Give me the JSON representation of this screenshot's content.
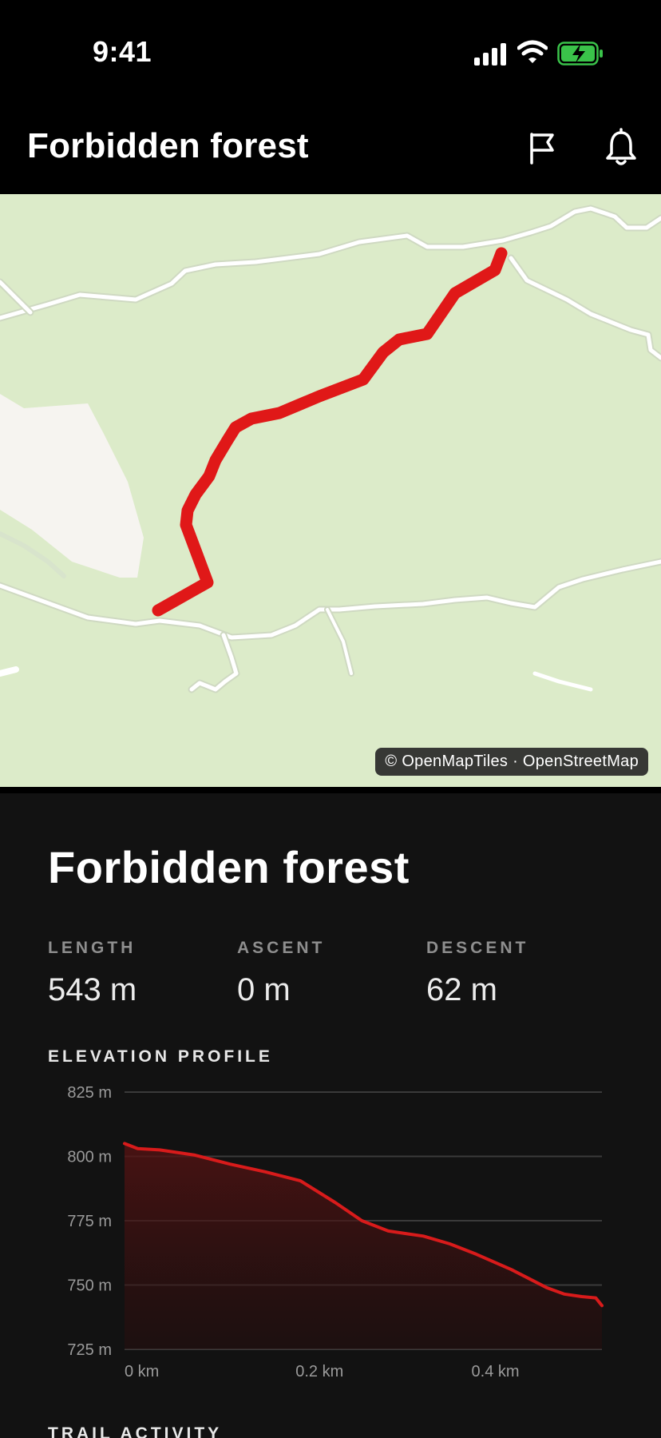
{
  "status_bar": {
    "time": "9:41"
  },
  "header": {
    "title": "Forbidden forest"
  },
  "map": {
    "attribution": "© OpenMapTiles · OpenStreetMap",
    "route_color": "#e01818"
  },
  "trail": {
    "name": "Forbidden forest",
    "stats": [
      {
        "label": "LENGTH",
        "value": "543 m"
      },
      {
        "label": "ASCENT",
        "value": "0 m"
      },
      {
        "label": "DESCENT",
        "value": "62 m"
      }
    ]
  },
  "elevation": {
    "heading": "ELEVATION PROFILE",
    "next_section": "TRAIL ACTIVITY"
  },
  "chart_data": {
    "type": "area",
    "title": "",
    "xlabel": "",
    "ylabel": "",
    "x_unit": "km",
    "y_unit": "m",
    "xlim": [
      0,
      0.543
    ],
    "ylim": [
      725,
      825
    ],
    "x_ticks": [
      "0 km",
      "0.2 km",
      "0.4 km"
    ],
    "y_ticks": [
      "825 m",
      "800 m",
      "775 m",
      "750 m",
      "725 m"
    ],
    "grid": true,
    "color": "#d81b1b",
    "x": [
      0,
      0.015,
      0.04,
      0.08,
      0.12,
      0.16,
      0.2,
      0.24,
      0.27,
      0.3,
      0.32,
      0.34,
      0.37,
      0.4,
      0.44,
      0.48,
      0.5,
      0.52,
      0.536,
      0.543
    ],
    "y": [
      805,
      803,
      802.5,
      800.5,
      797,
      794,
      790.5,
      782,
      775,
      771,
      770,
      769,
      766,
      762,
      756,
      749,
      746.5,
      745.5,
      745,
      742
    ]
  }
}
